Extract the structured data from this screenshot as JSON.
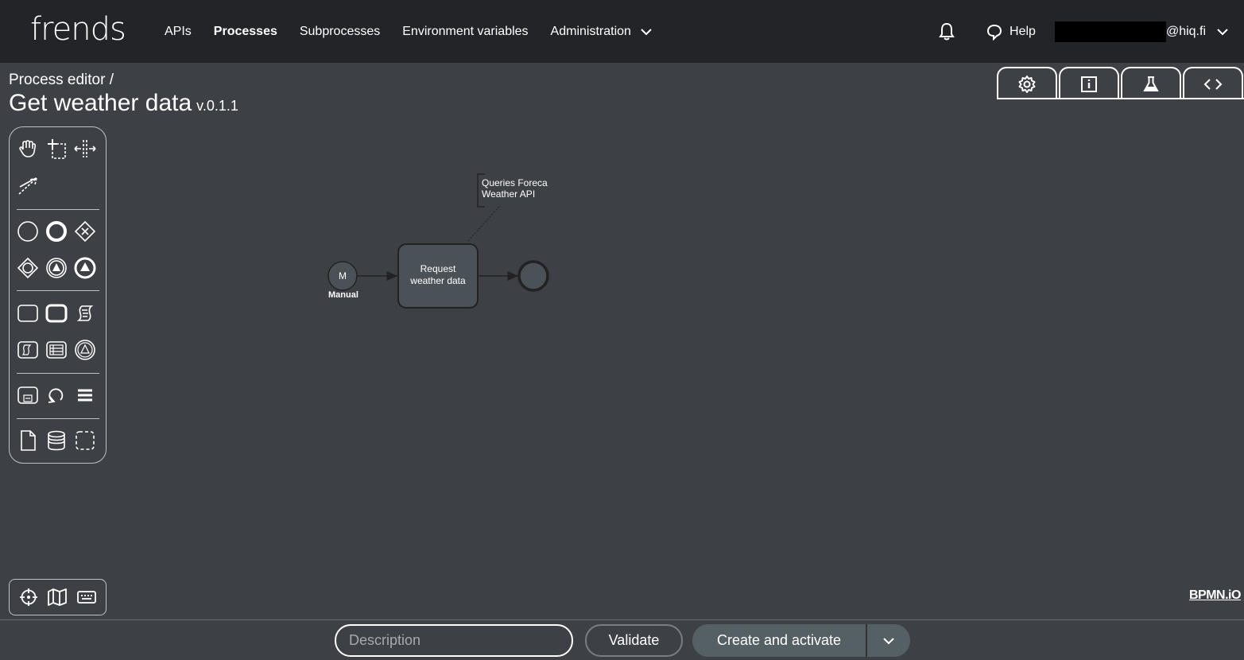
{
  "brand": {
    "logo": "frends"
  },
  "nav": {
    "items": [
      {
        "label": "APIs",
        "active": false
      },
      {
        "label": "Processes",
        "active": true
      },
      {
        "label": "Subprocesses",
        "active": false
      },
      {
        "label": "Environment variables",
        "active": false
      },
      {
        "label": "Administration",
        "active": false,
        "dropdown": true
      }
    ],
    "help_label": "Help",
    "user_suffix": "@hiq.fi",
    "icons": {
      "notifications": "bell-icon",
      "help": "speech-bubble-icon",
      "user_menu": "chevron-down-icon"
    }
  },
  "header": {
    "breadcrumb": "Process editor /",
    "title": "Get weather data",
    "version": "v.0.1.1"
  },
  "tabs": [
    {
      "name": "settings",
      "icon": "gear-icon"
    },
    {
      "name": "info",
      "icon": "info-icon"
    },
    {
      "name": "test",
      "icon": "flask-icon"
    },
    {
      "name": "code",
      "icon": "code-icon"
    }
  ],
  "palette": {
    "tools": [
      "hand-tool-icon",
      "lasso-tool-icon",
      "space-tool-icon",
      "connect-tool-icon"
    ],
    "events": [
      "start-event-icon",
      "end-event-icon",
      "exclusive-gateway-icon",
      "event-gateway-icon",
      "intermediate-event-icon",
      "throw-event-icon"
    ],
    "tasks": [
      "task-icon",
      "subprocess-icon",
      "script-icon",
      "script-task-icon",
      "table-task-icon",
      "call-activity-icon"
    ],
    "misc": [
      "collapsed-subprocess-icon",
      "loop-icon",
      "list-icon",
      "data-object-icon",
      "data-store-icon",
      "group-icon"
    ]
  },
  "minimap_tools": [
    "crosshair-icon",
    "map-icon",
    "keyboard-icon"
  ],
  "diagram": {
    "start_event": {
      "marker": "M",
      "label": "Manual"
    },
    "task": {
      "label_line1": "Request",
      "label_line2": "weather data"
    },
    "annotation": {
      "line1": "Queries Foreca",
      "line2": "Weather API"
    }
  },
  "watermark": "BPMN.iO",
  "footer": {
    "description_placeholder": "Description",
    "validate_label": "Validate",
    "create_label": "Create and activate"
  }
}
